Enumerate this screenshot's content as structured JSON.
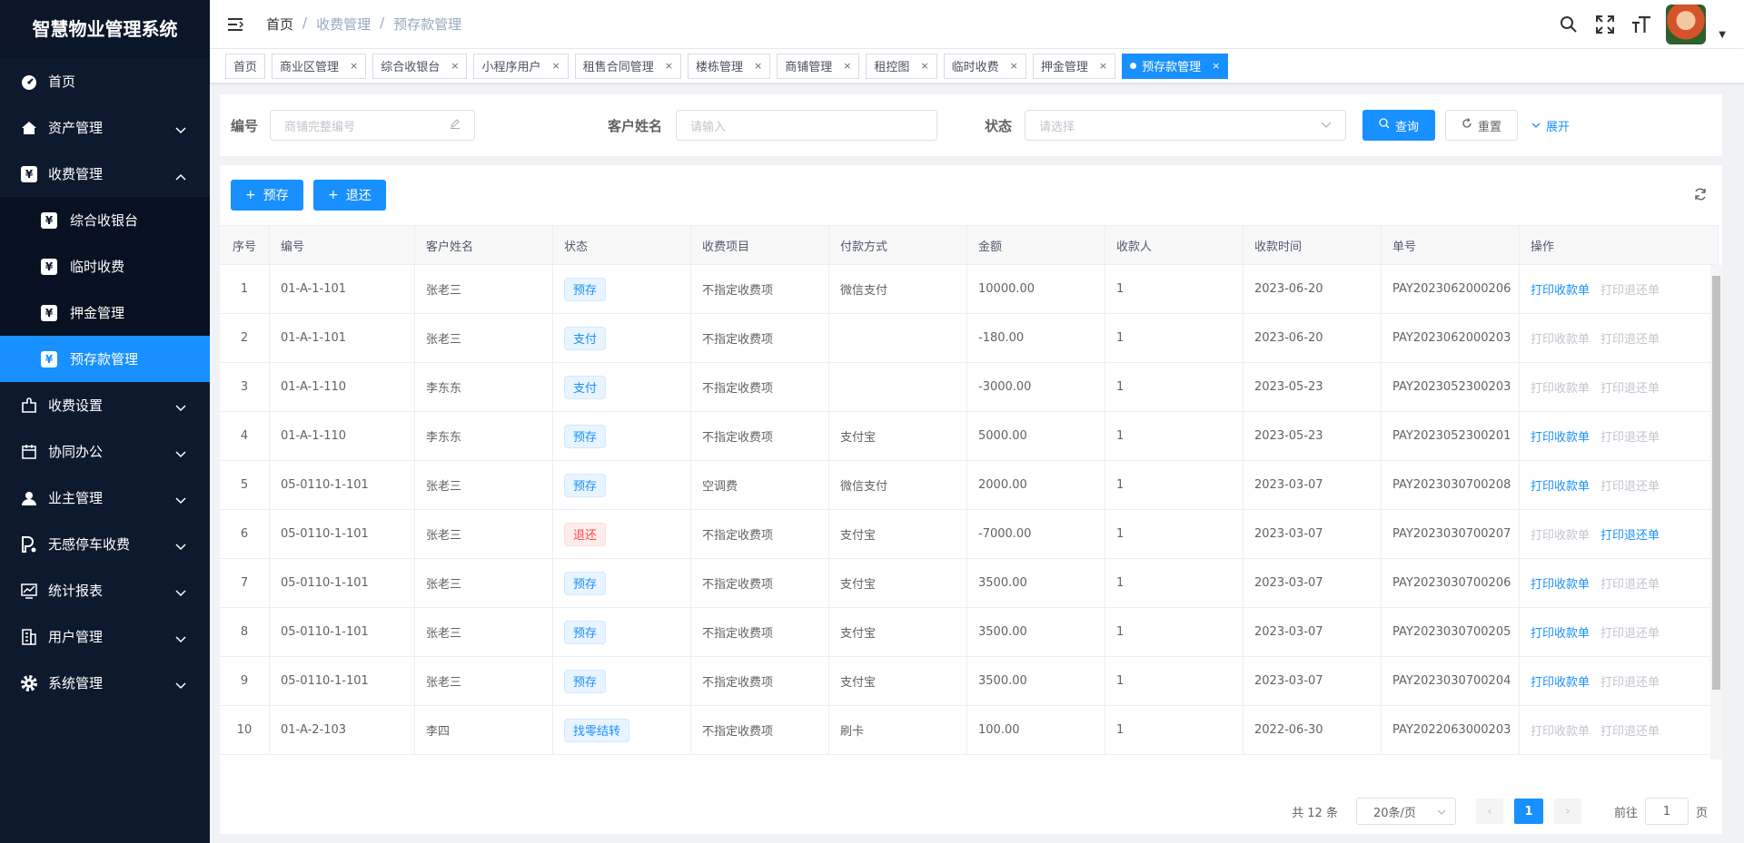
{
  "app": {
    "title": "智慧物业管理系统"
  },
  "sidebar": {
    "items": [
      {
        "label": "首页",
        "icon": "dashboard-icon"
      },
      {
        "label": "资产管理",
        "icon": "home-icon"
      },
      {
        "label": "收费管理",
        "icon": "yen-icon"
      },
      {
        "label": "收费设置",
        "icon": "plugin-icon"
      },
      {
        "label": "协同办公",
        "icon": "calendar-icon"
      },
      {
        "label": "业主管理",
        "icon": "user-icon"
      },
      {
        "label": "无感停车收费",
        "icon": "parking-icon"
      },
      {
        "label": "统计报表",
        "icon": "chart-icon"
      },
      {
        "label": "用户管理",
        "icon": "building-icon"
      },
      {
        "label": "系统管理",
        "icon": "gear-icon"
      }
    ],
    "sub_items": [
      {
        "label": "综合收银台"
      },
      {
        "label": "临时收费"
      },
      {
        "label": "押金管理"
      },
      {
        "label": "预存款管理"
      }
    ]
  },
  "header": {
    "breadcrumb": [
      "首页",
      "/",
      "收费管理",
      "/",
      "预存款管理"
    ]
  },
  "tags": [
    "首页",
    "商业区管理",
    "综合收银台",
    "小程序用户",
    "租售合同管理",
    "楼栋管理",
    "商铺管理",
    "租控图",
    "临时收费",
    "押金管理",
    "预存款管理"
  ],
  "search": {
    "code_label": "编号",
    "code_placeholder": "商铺完整编号",
    "name_label": "客户姓名",
    "name_placeholder": "请输入",
    "status_label": "状态",
    "status_placeholder": "请选择",
    "query_label": "查询",
    "reset_label": "重置",
    "expand_label": "展开"
  },
  "toolbar": {
    "deposit_label": "预存",
    "refund_label": "退还"
  },
  "table": {
    "columns": [
      "序号",
      "编号",
      "客户姓名",
      "状态",
      "收费项目",
      "付款方式",
      "金额",
      "收款人",
      "收款时间",
      "单号",
      "操作"
    ],
    "print_receipt": "打印收款单",
    "print_refund": "打印退还单",
    "rows": [
      {
        "idx": "1",
        "code": "01-A-1-101",
        "name": "张老三",
        "status": "预存",
        "status_type": "blue",
        "item": "不指定收费项",
        "pay": "微信支付",
        "amount": "10000.00",
        "payee": "1",
        "time": "2023-06-20",
        "no": "PAY2023062000206",
        "receipt": true,
        "refund": false
      },
      {
        "idx": "2",
        "code": "01-A-1-101",
        "name": "张老三",
        "status": "支付",
        "status_type": "blue",
        "item": "不指定收费项",
        "pay": "",
        "amount": "-180.00",
        "payee": "1",
        "time": "2023-06-20",
        "no": "PAY2023062000203",
        "receipt": false,
        "refund": false
      },
      {
        "idx": "3",
        "code": "01-A-1-110",
        "name": "李东东",
        "status": "支付",
        "status_type": "blue",
        "item": "不指定收费项",
        "pay": "",
        "amount": "-3000.00",
        "payee": "1",
        "time": "2023-05-23",
        "no": "PAY2023052300203",
        "receipt": false,
        "refund": false
      },
      {
        "idx": "4",
        "code": "01-A-1-110",
        "name": "李东东",
        "status": "预存",
        "status_type": "blue",
        "item": "不指定收费项",
        "pay": "支付宝",
        "amount": "5000.00",
        "payee": "1",
        "time": "2023-05-23",
        "no": "PAY2023052300201",
        "receipt": true,
        "refund": false
      },
      {
        "idx": "5",
        "code": "05-0110-1-101",
        "name": "张老三",
        "status": "预存",
        "status_type": "blue",
        "item": "空调费",
        "pay": "微信支付",
        "amount": "2000.00",
        "payee": "1",
        "time": "2023-03-07",
        "no": "PAY2023030700208",
        "receipt": true,
        "refund": false
      },
      {
        "idx": "6",
        "code": "05-0110-1-101",
        "name": "张老三",
        "status": "退还",
        "status_type": "red",
        "item": "不指定收费项",
        "pay": "支付宝",
        "amount": "-7000.00",
        "payee": "1",
        "time": "2023-03-07",
        "no": "PAY2023030700207",
        "receipt": false,
        "refund": true
      },
      {
        "idx": "7",
        "code": "05-0110-1-101",
        "name": "张老三",
        "status": "预存",
        "status_type": "blue",
        "item": "不指定收费项",
        "pay": "支付宝",
        "amount": "3500.00",
        "payee": "1",
        "time": "2023-03-07",
        "no": "PAY2023030700206",
        "receipt": true,
        "refund": false
      },
      {
        "idx": "8",
        "code": "05-0110-1-101",
        "name": "张老三",
        "status": "预存",
        "status_type": "blue",
        "item": "不指定收费项",
        "pay": "支付宝",
        "amount": "3500.00",
        "payee": "1",
        "time": "2023-03-07",
        "no": "PAY2023030700205",
        "receipt": true,
        "refund": false
      },
      {
        "idx": "9",
        "code": "05-0110-1-101",
        "name": "张老三",
        "status": "预存",
        "status_type": "blue",
        "item": "不指定收费项",
        "pay": "支付宝",
        "amount": "3500.00",
        "payee": "1",
        "time": "2023-03-07",
        "no": "PAY2023030700204",
        "receipt": true,
        "refund": false
      },
      {
        "idx": "10",
        "code": "01-A-2-103",
        "name": "李四",
        "status": "找零结转",
        "status_type": "blue",
        "item": "不指定收费项",
        "pay": "刷卡",
        "amount": "100.00",
        "payee": "1",
        "time": "2022-06-30",
        "no": "PAY2022063000203",
        "receipt": false,
        "refund": false
      }
    ]
  },
  "pager": {
    "total": "共 12 条",
    "size": "20条/页",
    "page": "1",
    "goto_label": "前往",
    "goto_value": "1",
    "page_suffix": "页"
  },
  "colors": {
    "accent": "#1890ff",
    "sidebar": "#0d1a2e",
    "danger": "#ff4949"
  }
}
